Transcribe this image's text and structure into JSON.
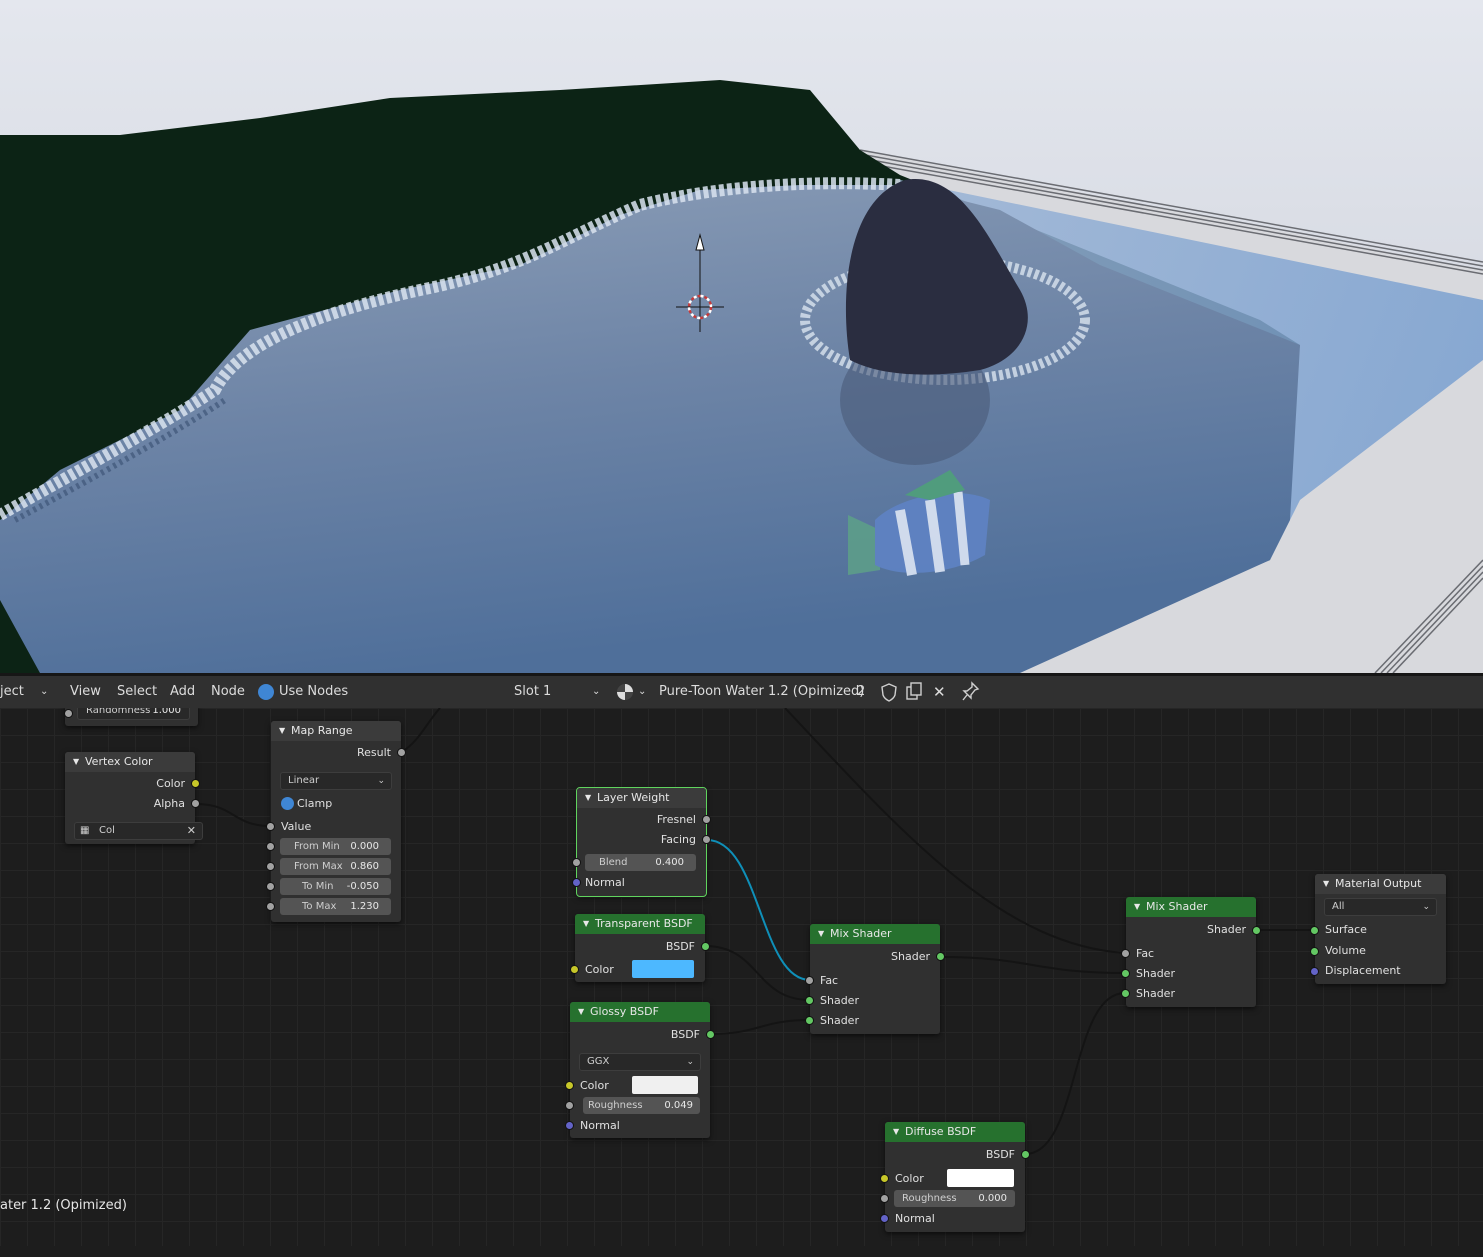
{
  "header": {
    "object_menu": "ject",
    "menus": [
      "View",
      "Select",
      "Add",
      "Node"
    ],
    "use_nodes_label": "Use Nodes",
    "slot": "Slot 1",
    "material_name": "Pure-Toon Water 1.2 (Opimized)",
    "user_count": "2"
  },
  "nodes": {
    "randomness": {
      "label": "Randomness",
      "value": "1.000"
    },
    "vertex_color": {
      "title": "Vertex Color",
      "out_color": "Color",
      "out_alpha": "Alpha",
      "layer": "Col"
    },
    "map_range": {
      "title": "Map Range",
      "out_result": "Result",
      "interpolation": "Linear",
      "clamp": "Clamp",
      "in_value": "Value",
      "fields": [
        {
          "label": "From Min",
          "value": "0.000"
        },
        {
          "label": "From Max",
          "value": "0.860"
        },
        {
          "label": "To Min",
          "value": "-0.050"
        },
        {
          "label": "To Max",
          "value": "1.230"
        }
      ]
    },
    "layer_weight": {
      "title": "Layer Weight",
      "out_fresnel": "Fresnel",
      "out_facing": "Facing",
      "blend_label": "Blend",
      "blend_value": "0.400",
      "in_normal": "Normal"
    },
    "transparent": {
      "title": "Transparent BSDF",
      "out_bsdf": "BSDF",
      "in_color": "Color",
      "color_hex": "#4db8ff"
    },
    "glossy": {
      "title": "Glossy BSDF",
      "out_bsdf": "BSDF",
      "distribution": "GGX",
      "in_color": "Color",
      "color_hex": "#f0f0f0",
      "roughness_label": "Roughness",
      "roughness_value": "0.049",
      "in_normal": "Normal"
    },
    "mix1": {
      "title": "Mix Shader",
      "out_shader": "Shader",
      "in_fac": "Fac",
      "in_shader1": "Shader",
      "in_shader2": "Shader"
    },
    "mix2": {
      "title": "Mix Shader",
      "out_shader": "Shader",
      "in_fac": "Fac",
      "in_shader1": "Shader",
      "in_shader2": "Shader"
    },
    "diffuse": {
      "title": "Diffuse BSDF",
      "out_bsdf": "BSDF",
      "in_color": "Color",
      "color_hex": "#ffffff",
      "roughness_label": "Roughness",
      "roughness_value": "0.000",
      "in_normal": "Normal"
    },
    "output": {
      "title": "Material Output",
      "target": "All",
      "in_surface": "Surface",
      "in_volume": "Volume",
      "in_displacement": "Displacement"
    }
  },
  "status_text": "ater 1.2 (Opimized)",
  "colors": {
    "accent": "#3f86d4",
    "node_header_green": "#26712e",
    "selected_outline": "#60d45e",
    "facing_wire": "#0f8fb8"
  }
}
